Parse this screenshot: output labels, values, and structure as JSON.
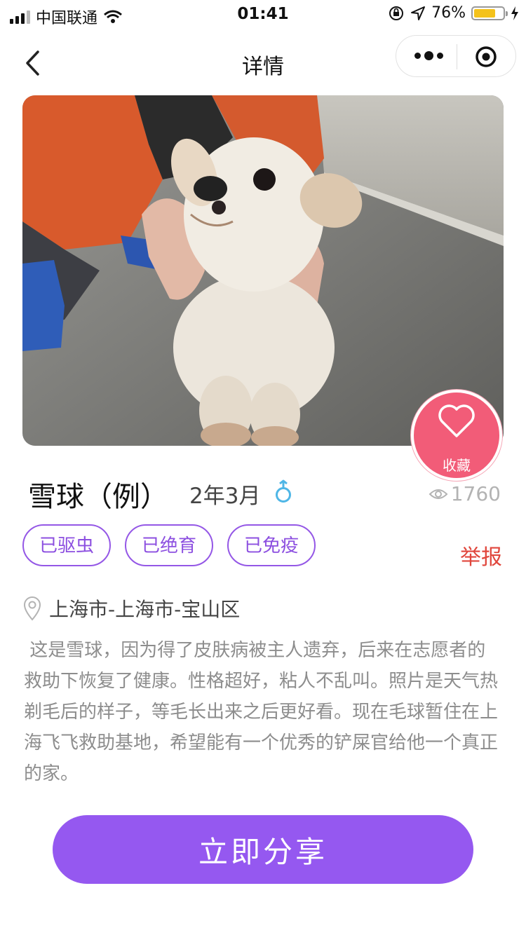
{
  "status_bar": {
    "carrier": "中国联通",
    "time": "01:41",
    "battery": "76%",
    "battery_level": 0.76
  },
  "nav": {
    "title": "详情"
  },
  "gallery": {
    "image_count": 4,
    "active_index": 2
  },
  "favorite": {
    "label": "收藏",
    "color": "#f25c78"
  },
  "pet": {
    "name": "雪球（例）",
    "age": "2年3月",
    "gender_icon": "male-icon",
    "views": "1760"
  },
  "tags": [
    "已驱虫",
    "已绝育",
    "已免疫"
  ],
  "report_label": "举报",
  "location": "上海市-上海市-宝山区",
  "description": " 这是雪球，因为得了皮肤病被主人遗弃，后来在志愿者的救助下恢复了健康。性格超好，粘人不乱叫。照片是天气热剃毛后的样子，等毛长出来之后更好看。现在毛球暂住在上海飞飞救助基地，希望能有一个优秀的铲屎官给他一个真正的家。",
  "share_label": "立即分享",
  "colors": {
    "accent": "#9558f0",
    "report": "#e0463c",
    "favorite": "#f25c78"
  }
}
